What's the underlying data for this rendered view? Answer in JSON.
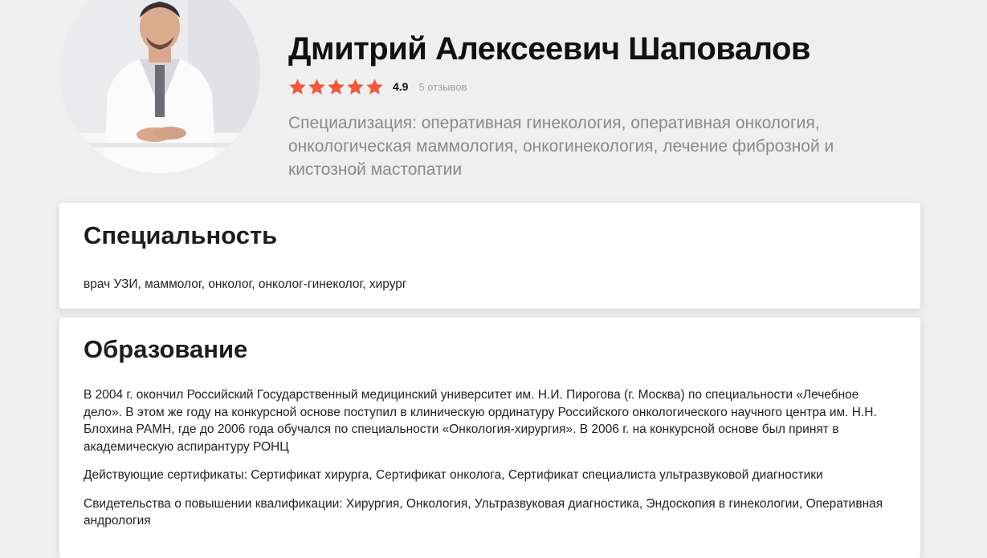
{
  "doctor": {
    "name": "Дмитрий Алексеевич Шаповалов",
    "rating": 4.9,
    "rating_label": "4.9",
    "reviews": "5 отзывов",
    "specialization": "Специализация: оперативная гинекология, оперативная онкология, онкологическая маммология, онкогинекология, лечение фиброзной и кистозной мастопатии"
  },
  "specialty_card": {
    "title": "Специальность",
    "text": "врач УЗИ, маммолог, онколог, онколог-гинеколог, хирург"
  },
  "education_card": {
    "title": "Образование",
    "paragraphs": [
      "В 2004 г. окончил Российский Государственный медицинский университет им. Н.И. Пирогова (г. Москва) по специальности «Лечебное дело». В этом же году на конкурсной основе поступил в клиническую ординатуру Российского онкологического научного центра им. Н.Н. Блохина РАМН, где до 2006 года обучался по специальности «Онкология-хирургия». В 2006 г. на конкурсной основе был принят в академическую аспирантуру РОНЦ",
      "Действующие сертификаты: Сертификат хирурга, Сертификат онколога, Сертификат специалиста ультразвуковой диагностики",
      "Свидетельства о повышении квалификации: Хирургия, Онкология, Ультразвуковая диагностика, Эндоскопия в гинекологии, Оперативная андрология"
    ]
  },
  "colors": {
    "star": "#f05a3c",
    "page_bg": "#efefef",
    "muted_text": "#8a8a8a"
  }
}
